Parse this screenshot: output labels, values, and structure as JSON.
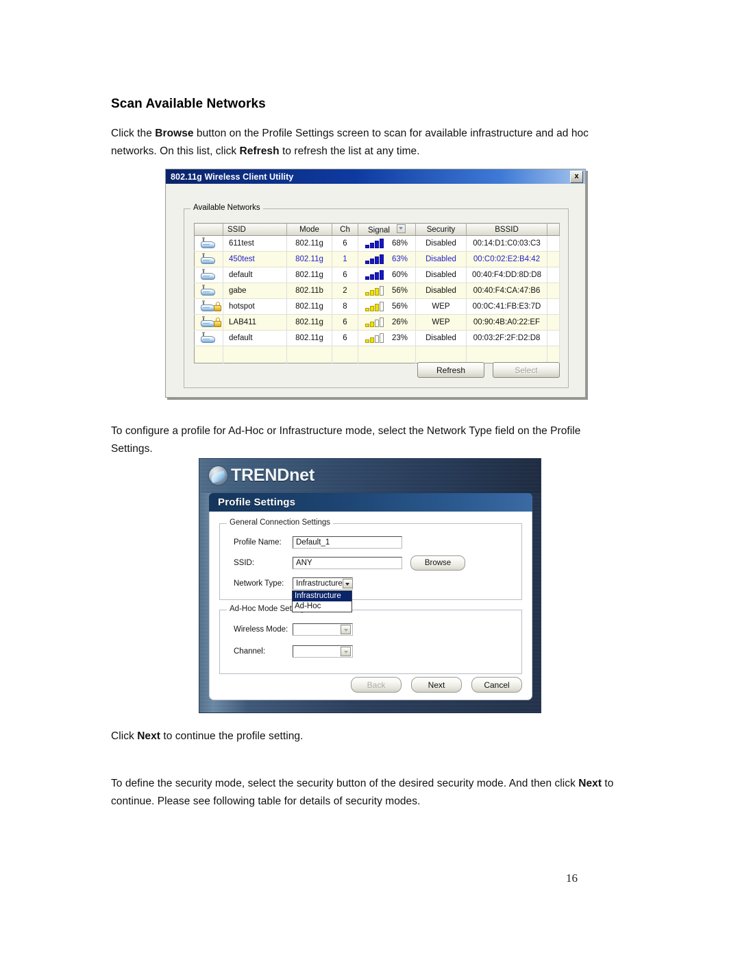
{
  "document": {
    "heading": "Scan Available Networks",
    "paragraph_1_pre": "Click the ",
    "paragraph_1_bold": "Browse",
    "paragraph_1_mid": " button on the Profile Settings screen to scan for available infrastructure and ad hoc networks. On this list, click ",
    "paragraph_1_bold2": "Refresh",
    "paragraph_1_post": " to refresh the list at any time.",
    "paragraph_2": "To configure a profile for Ad-Hoc or Infrastructure mode, select the Network Type field on the Profile Settings.",
    "paragraph_3_pre": "Click ",
    "paragraph_3_bold": "Next",
    "paragraph_3_post": " to continue the profile setting.",
    "paragraph_4_pre": "To define the security mode, select the security button of the desired security mode. And then click ",
    "paragraph_4_bold": "Next",
    "paragraph_4_post": " to continue. Please see following table for details of security modes.",
    "page_number": "16"
  },
  "scan_dialog": {
    "title": "802.11g Wireless Client Utility",
    "close_label": "x",
    "group_legend": "Available Networks",
    "columns": [
      "",
      "SSID",
      "Mode",
      "Ch",
      "Signal",
      "Security",
      "BSSID"
    ],
    "sorted_column": "Signal",
    "rows": [
      {
        "ssid": "611test",
        "mode": "802.11g",
        "ch": "6",
        "signal": "68%",
        "bars": 4,
        "bar_color": "blue",
        "security": "Disabled",
        "bssid": "00:14:D1:C0:03:C3",
        "locked": false,
        "selected": false
      },
      {
        "ssid": "450test",
        "mode": "802.11g",
        "ch": "1",
        "signal": "63%",
        "bars": 4,
        "bar_color": "blue",
        "security": "Disabled",
        "bssid": "00:C0:02:E2:B4:42",
        "locked": false,
        "selected": true
      },
      {
        "ssid": "default",
        "mode": "802.11g",
        "ch": "6",
        "signal": "60%",
        "bars": 4,
        "bar_color": "blue",
        "security": "Disabled",
        "bssid": "00:40:F4:DD:8D:D8",
        "locked": false,
        "selected": false
      },
      {
        "ssid": "gabe",
        "mode": "802.11b",
        "ch": "2",
        "signal": "56%",
        "bars": 3,
        "bar_color": "yellow",
        "security": "Disabled",
        "bssid": "00:40:F4:CA:47:B6",
        "locked": false,
        "selected": false
      },
      {
        "ssid": "hotspot",
        "mode": "802.11g",
        "ch": "8",
        "signal": "56%",
        "bars": 3,
        "bar_color": "yellow",
        "security": "WEP",
        "bssid": "00:0C:41:FB:E3:7D",
        "locked": true,
        "selected": false
      },
      {
        "ssid": "LAB411",
        "mode": "802.11g",
        "ch": "6",
        "signal": "26%",
        "bars": 2,
        "bar_color": "yellow",
        "security": "WEP",
        "bssid": "00:90:4B:A0:22:EF",
        "locked": true,
        "selected": false
      },
      {
        "ssid": "default",
        "mode": "802.11g",
        "ch": "6",
        "signal": "23%",
        "bars": 2,
        "bar_color": "yellow",
        "security": "Disabled",
        "bssid": "00:03:2F:2F:D2:D8",
        "locked": false,
        "selected": false
      }
    ],
    "refresh_label": "Refresh",
    "select_label": "Select"
  },
  "profile_dialog": {
    "brand": "TREND",
    "brand_suffix": "net",
    "tab_label": "Profile Settings",
    "general_legend": "General Connection Settings",
    "profile_name_label": "Profile Name:",
    "profile_name_value": "Default_1",
    "ssid_label": "SSID:",
    "ssid_value": "ANY",
    "browse_label": "Browse",
    "network_type_label": "Network Type:",
    "network_type_value": "Infrastructure",
    "network_type_options": [
      "Infrastructure",
      "Ad-Hoc"
    ],
    "adhoc_legend": "Ad-Hoc Mode Settings",
    "wireless_mode_label": "Wireless Mode:",
    "wireless_mode_value": "",
    "channel_label": "Channel:",
    "channel_value": "",
    "back_label": "Back",
    "next_label": "Next",
    "cancel_label": "Cancel"
  },
  "colors": {
    "titlebar_start": "#0a246a",
    "selected_row_text": "#2222cc",
    "alt_row_bg": "#fcfbe4",
    "signal_blue": "#1717c8",
    "signal_yellow": "#f2e000",
    "lock_gold": "#f5cd4a",
    "brand_panel": "#1d3352"
  }
}
